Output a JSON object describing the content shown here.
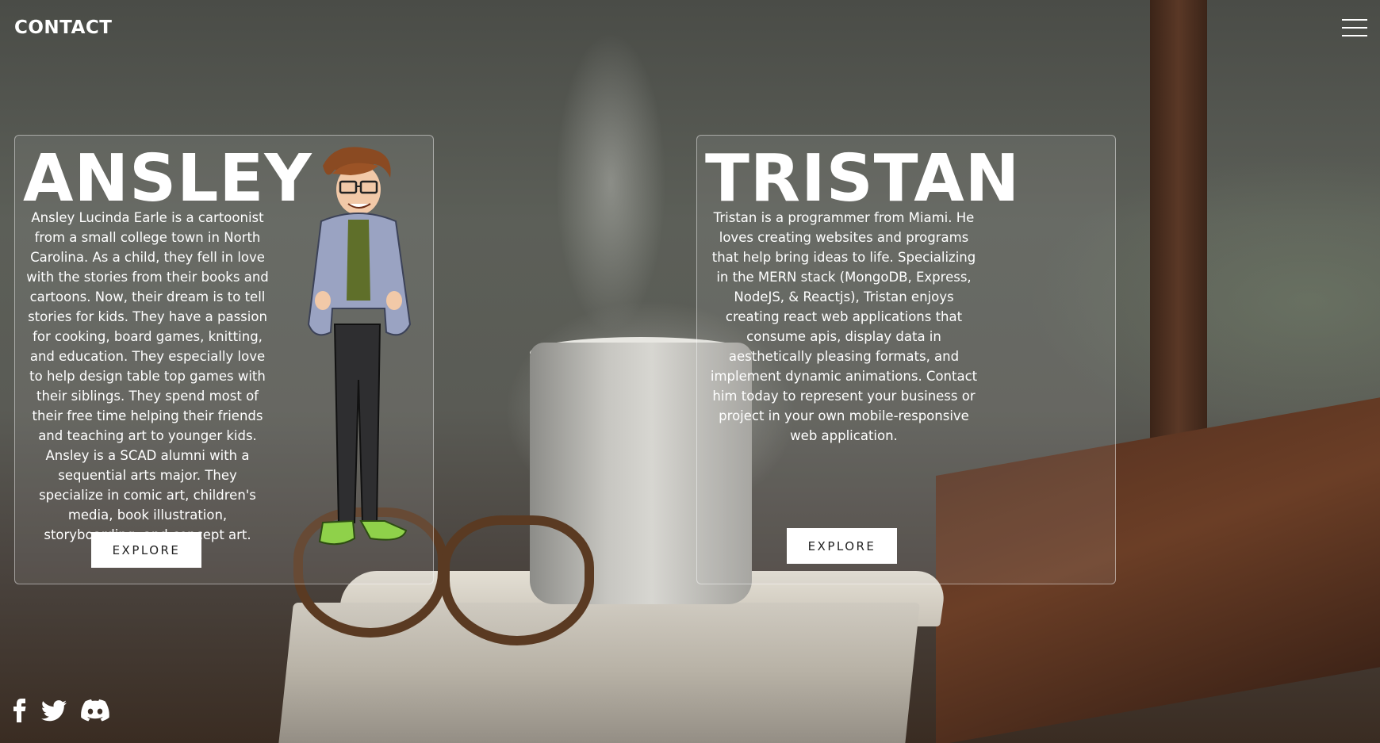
{
  "header": {
    "brand": "CONTACT",
    "menu_icon": "hamburger-menu-icon"
  },
  "cards": [
    {
      "name": "ANSLEY",
      "bio": "Ansley Lucinda Earle is a cartoonist from a small college town in North Carolina. As a child, they fell in love with the stories from their books and cartoons. Now, their dream is to tell stories for kids. They have a passion for cooking, board games, knitting, and education. They especially love to help design table top games with their siblings. They spend most of their free time helping their friends and teaching art to younger kids. Ansley is a SCAD alumni with a sequential arts major. They specialize in comic art, children's media, book illustration, storyboarding, and concept art.",
      "button_label": "EXPLORE"
    },
    {
      "name": "TRISTAN",
      "bio": "Tristan is a programmer from Miami. He loves creating websites and programs that help bring ideas to life. Specializing in the MERN stack (MongoDB, Express, NodeJS, & Reactjs), Tristan enjoys creating react web applications that consume apis, display data in aesthetically pleasing formats, and implement dynamic animations. Contact him today to represent your business or project in your own mobile-responsive web application.",
      "button_label": "EXPLORE"
    }
  ],
  "social": {
    "icons": [
      "facebook-icon",
      "twitter-icon",
      "discord-icon"
    ]
  },
  "colors": {
    "text": "#ffffff",
    "button_bg": "#ffffff",
    "button_text": "#222222"
  }
}
